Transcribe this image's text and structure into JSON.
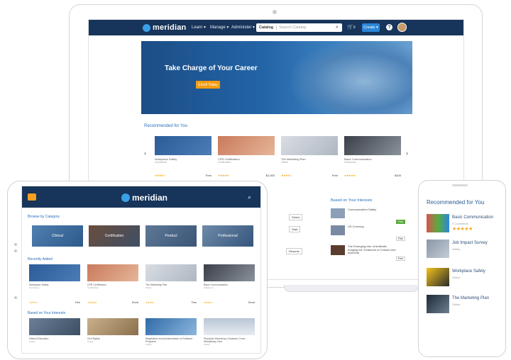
{
  "desktop": {
    "brand": "meridian",
    "nav": [
      "Learn ▾",
      "Manage ▾",
      "Administer ▾"
    ],
    "search": {
      "category": "Catalog",
      "placeholder": "Search Catalog"
    },
    "cart_count": "0",
    "create_label": "Create ▾",
    "help": "?",
    "hero": {
      "title": "Take Charge of Your Career",
      "button": "Enroll Today"
    },
    "recommended_title": "Recommended for You",
    "cards": [
      {
        "title": "Workplace Safety",
        "sub": "Curriculum",
        "price": "Free",
        "stars": "★★★★☆"
      },
      {
        "title": "CPR Certification",
        "sub": "Certification",
        "price": "$1,000",
        "stars": "★★★★★"
      },
      {
        "title": "The Marketing Plan",
        "sub": "Online",
        "price": "Free",
        "stars": "★★★★☆"
      },
      {
        "title": "Basic Communication",
        "sub": "Classroom",
        "price": "$100",
        "stars": "★★★★★"
      }
    ],
    "interests_title": "Based on Your Interests",
    "interests": [
      {
        "title": "Communication Safety",
        "sub": "Recommended",
        "badge": "Free"
      },
      {
        "title": "US Currency",
        "sub": "Online",
        "badge": "Free"
      },
      {
        "title": "The Emerging Use of Antibiotic Imaging the Treatment of Critical Limb Ischemia",
        "sub": "Self Study",
        "badge": "Free"
      }
    ],
    "row_buttons": [
      "Select",
      "Start",
      "Resume"
    ]
  },
  "tablet": {
    "brand": "meridian",
    "browse_title": "Browse by Category",
    "categories": [
      "Clinical",
      "Certification",
      "Product",
      "Professional"
    ],
    "recent_title": "Recently Added",
    "cards": [
      {
        "title": "Workplace Safety",
        "sub": "Curriculum",
        "price": "Free",
        "stars": "★★★★☆"
      },
      {
        "title": "CPR Certification",
        "sub": "Certification",
        "price": "Enroll",
        "stars": "★★★★★"
      },
      {
        "title": "The Marketing Plan",
        "sub": "Online",
        "price": "Free",
        "stars": "★★★★☆"
      },
      {
        "title": "Basic Communication",
        "sub": "Classroom",
        "price": "Enroll",
        "stars": "★★★★☆"
      }
    ],
    "interests_title": "Based on Your Interests",
    "bottom_cards": [
      {
        "title": "Patient Education",
        "sub": "Online"
      },
      {
        "title": "Civil Rights",
        "sub": "Online"
      },
      {
        "title": "Negotiation and Administration of Software Programs",
        "sub": "Online"
      },
      {
        "title": "Physician Residency Guidance Cross Disciplinary Care",
        "sub": "Online"
      }
    ]
  },
  "phone": {
    "title": "Recommended for You",
    "items": [
      {
        "title": "Basic Communication",
        "sub": "0 Comments",
        "stars": "★★★★★"
      },
      {
        "title": "Job Impact Survey",
        "sub": "Safety",
        "stars": ""
      },
      {
        "title": "Workplace Safety",
        "sub": "Online",
        "stars": ""
      },
      {
        "title": "The Marketing Plan",
        "sub": "Online",
        "stars": ""
      }
    ]
  },
  "colors": {
    "navy": "#17345a",
    "accent": "#2a6fb7",
    "orange": "#f39c12",
    "star": "#f4a81c"
  }
}
